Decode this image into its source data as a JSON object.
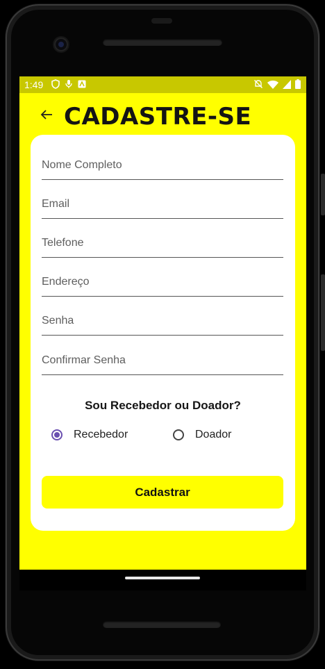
{
  "status_bar": {
    "time": "1:49",
    "left_icons": [
      "shield-icon",
      "mic-icon",
      "accessibility-icon"
    ],
    "right_icons": [
      "mute-icon",
      "wifi-icon",
      "signal-icon",
      "battery-icon"
    ]
  },
  "app_bar": {
    "back_icon": "arrow-back-icon",
    "title": "CADASTRE-SE"
  },
  "form": {
    "fields": [
      {
        "placeholder": "Nome Completo",
        "value": ""
      },
      {
        "placeholder": "Email",
        "value": ""
      },
      {
        "placeholder": "Telefone",
        "value": ""
      },
      {
        "placeholder": "Endereço",
        "value": ""
      },
      {
        "placeholder": "Senha",
        "value": ""
      },
      {
        "placeholder": "Confirmar Senha",
        "value": ""
      }
    ],
    "question": "Sou Recebedor ou Doador?",
    "options": [
      {
        "label": "Recebedor",
        "selected": true
      },
      {
        "label": "Doador",
        "selected": false
      }
    ],
    "submit_label": "Cadastrar"
  },
  "colors": {
    "background": "#ffff00",
    "status_bar": "#c8c800",
    "card": "#ffffff",
    "radio_selected": "#6a4fb0",
    "text": "#141414"
  }
}
